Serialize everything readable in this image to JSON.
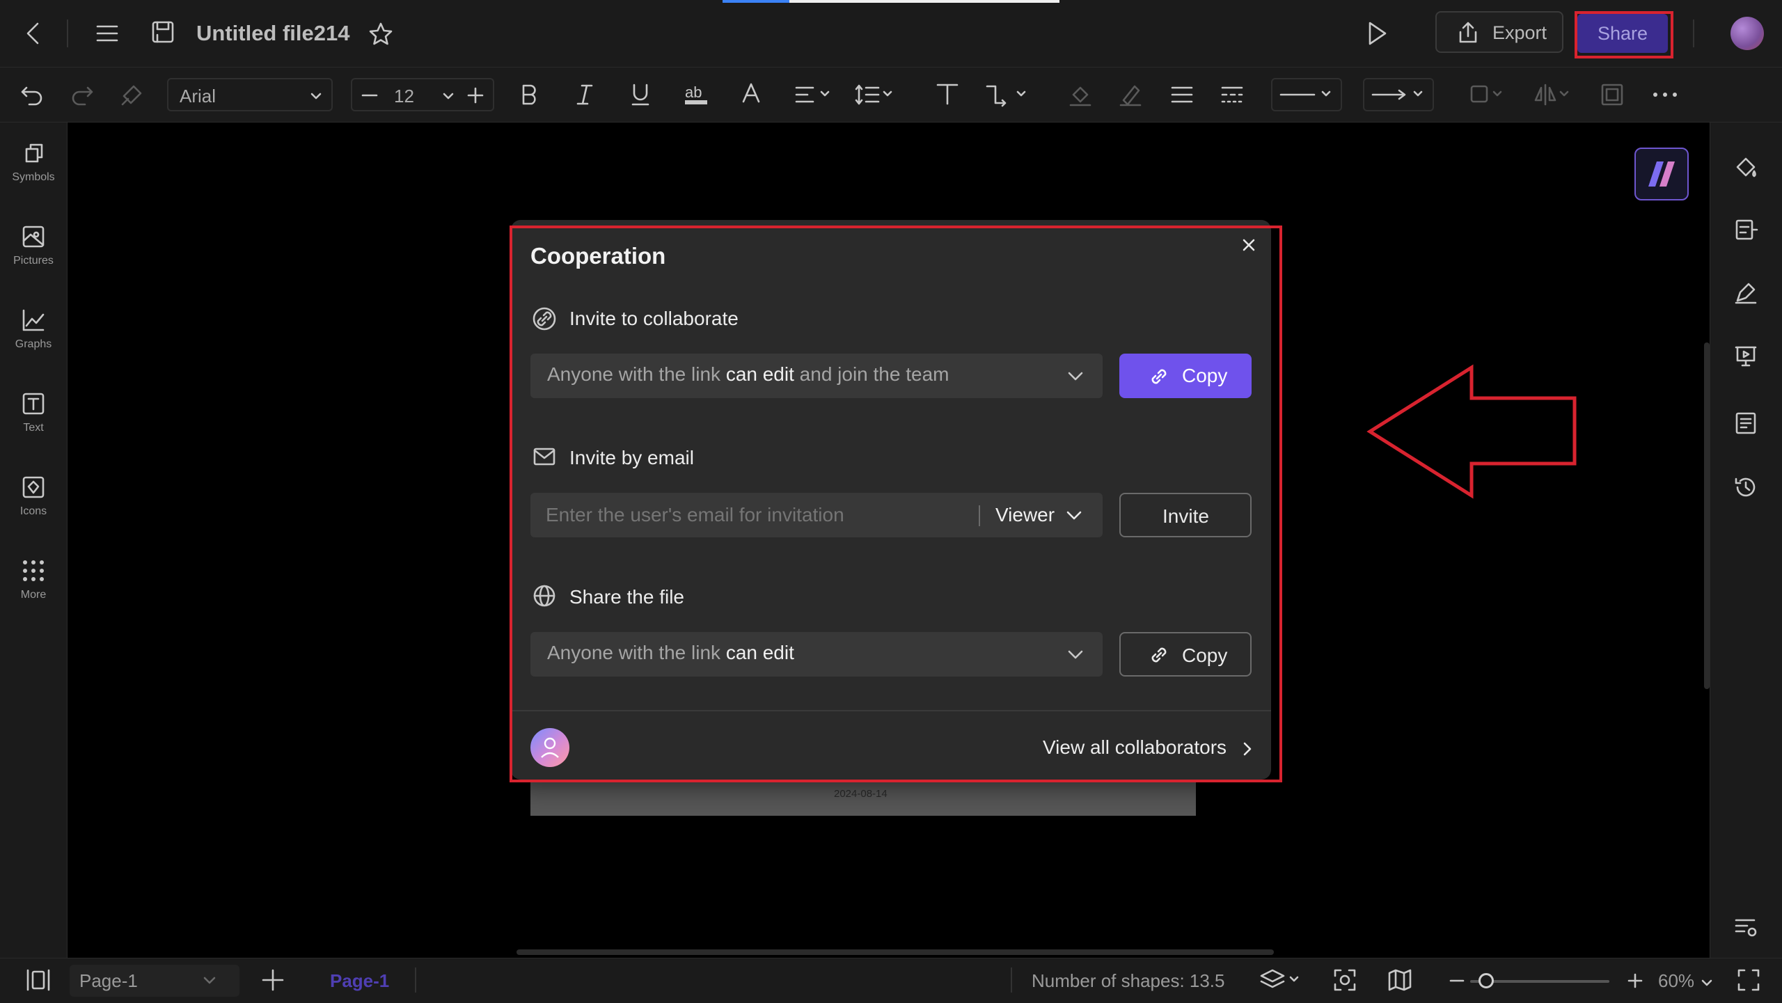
{
  "header": {
    "title": "Untitled file214",
    "export_label": "Export",
    "share_label": "Share"
  },
  "toolbar": {
    "font": "Arial",
    "font_size": "12"
  },
  "left_sidebar": {
    "items": [
      {
        "label": "Symbols"
      },
      {
        "label": "Pictures"
      },
      {
        "label": "Graphs"
      },
      {
        "label": "Text"
      },
      {
        "label": "Icons"
      },
      {
        "label": "More"
      }
    ]
  },
  "canvas": {
    "page_date": "2024-08-14"
  },
  "modal": {
    "title": "Cooperation",
    "collaborate": {
      "title": "Invite to collaborate",
      "select_prefix": "Anyone with the link ",
      "select_bold": "can edit",
      "select_suffix": " and join the team",
      "copy_label": "Copy"
    },
    "email": {
      "title": "Invite by email",
      "placeholder": "Enter the user's email for invitation",
      "role": "Viewer",
      "invite_label": "Invite"
    },
    "share_file": {
      "title": "Share the file",
      "select_prefix": "Anyone with the link ",
      "select_bold": "can edit",
      "copy_label": "Copy"
    },
    "view_all_label": "View all collaborators"
  },
  "bottom_bar": {
    "page_select": "Page-1",
    "page_tab": "Page-1",
    "shape_count": "Number of shapes: 13.5",
    "zoom": "60%"
  },
  "colors": {
    "accent": "#6f52ec",
    "share_button": "#3b2c8f",
    "highlight": "#d8232f"
  }
}
